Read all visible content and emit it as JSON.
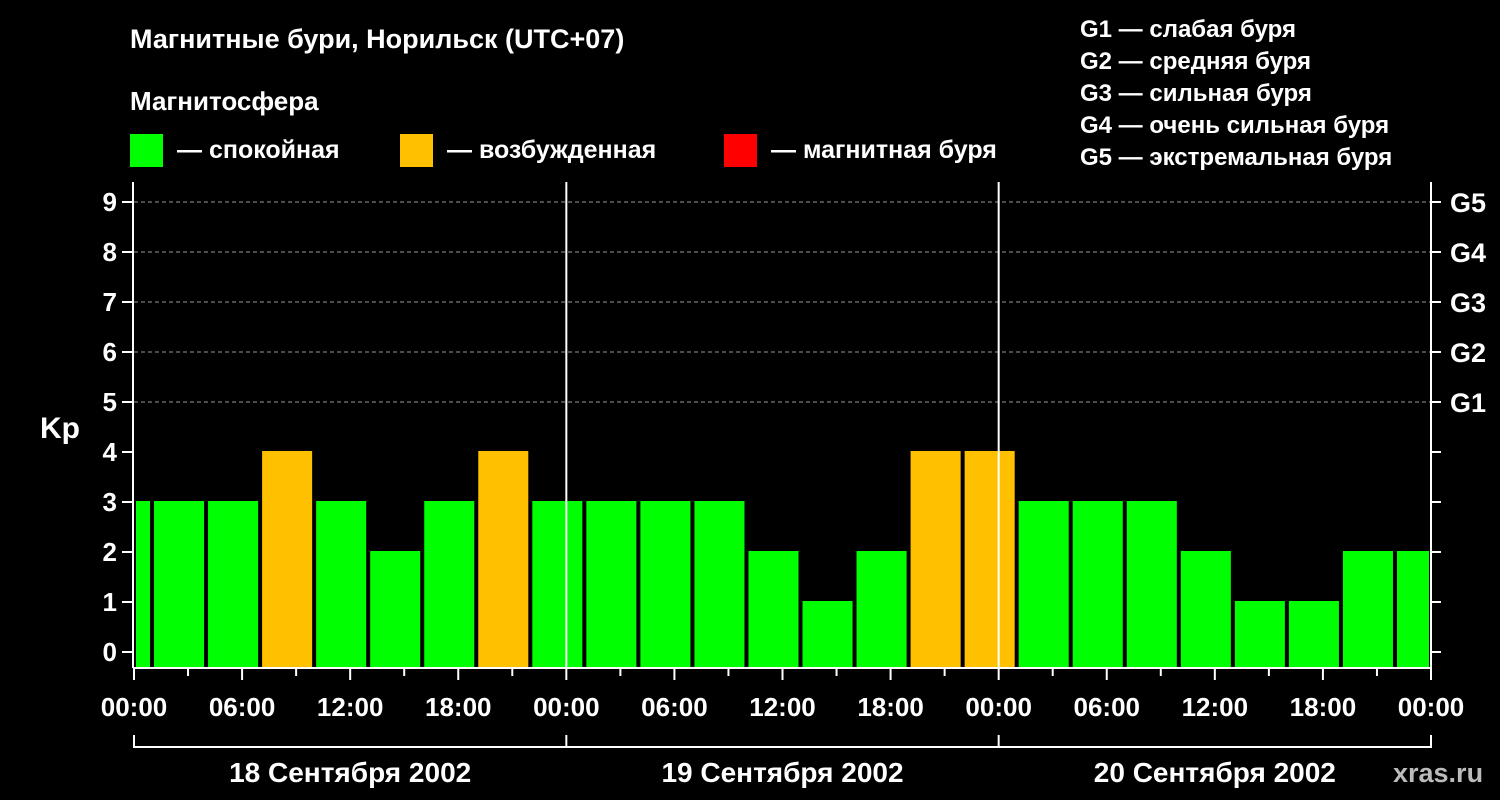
{
  "title": "Магнитные бури, Норильск (UTC+07)",
  "legend": {
    "heading": "Магнитосфера",
    "items": [
      {
        "label": "— спокойная",
        "color": "#00ff00"
      },
      {
        "label": "— возбужденная",
        "color": "#ffc000"
      },
      {
        "label": "— магнитная буря",
        "color": "#ff0000"
      }
    ]
  },
  "storm_scale": [
    "G1 — слабая буря",
    "G2 — средняя буря",
    "G3 — сильная буря",
    "G4 — очень сильная буря",
    "G5 — экстремальная буря"
  ],
  "watermark": "xras.ru",
  "chart_data": {
    "type": "bar",
    "ylabel": "Kp",
    "ylim": [
      0,
      9
    ],
    "y_ticks": [
      "0",
      "1",
      "2",
      "3",
      "4",
      "5",
      "6",
      "7",
      "8",
      "9"
    ],
    "right_ticks": [
      {
        "value": 5,
        "label": "G1"
      },
      {
        "value": 6,
        "label": "G2"
      },
      {
        "value": 7,
        "label": "G3"
      },
      {
        "value": 8,
        "label": "G4"
      },
      {
        "value": 9,
        "label": "G5"
      }
    ],
    "grid": "dashed horizontal at Kp 5–9",
    "x_range_hours": [
      0,
      72
    ],
    "x_tick_labels": [
      "00:00",
      "06:00",
      "12:00",
      "18:00",
      "00:00",
      "06:00",
      "12:00",
      "18:00",
      "00:00",
      "06:00",
      "12:00",
      "18:00",
      "00:00"
    ],
    "day_labels": [
      "18 Сентября 2002",
      "19 Сентября 2002",
      "20 Сентября 2002"
    ],
    "bars": [
      {
        "start": 0,
        "end": 1,
        "kp": 3,
        "level": "quiet"
      },
      {
        "start": 1,
        "end": 4,
        "kp": 3,
        "level": "quiet"
      },
      {
        "start": 4,
        "end": 7,
        "kp": 3,
        "level": "quiet"
      },
      {
        "start": 7,
        "end": 10,
        "kp": 4,
        "level": "active"
      },
      {
        "start": 10,
        "end": 13,
        "kp": 3,
        "level": "quiet"
      },
      {
        "start": 13,
        "end": 16,
        "kp": 2,
        "level": "quiet"
      },
      {
        "start": 16,
        "end": 19,
        "kp": 3,
        "level": "quiet"
      },
      {
        "start": 19,
        "end": 22,
        "kp": 4,
        "level": "active"
      },
      {
        "start": 22,
        "end": 25,
        "kp": 3,
        "level": "quiet"
      },
      {
        "start": 25,
        "end": 28,
        "kp": 3,
        "level": "quiet"
      },
      {
        "start": 28,
        "end": 31,
        "kp": 3,
        "level": "quiet"
      },
      {
        "start": 31,
        "end": 34,
        "kp": 3,
        "level": "quiet"
      },
      {
        "start": 34,
        "end": 37,
        "kp": 2,
        "level": "quiet"
      },
      {
        "start": 37,
        "end": 40,
        "kp": 1,
        "level": "quiet"
      },
      {
        "start": 40,
        "end": 43,
        "kp": 2,
        "level": "quiet"
      },
      {
        "start": 43,
        "end": 46,
        "kp": 4,
        "level": "active"
      },
      {
        "start": 46,
        "end": 49,
        "kp": 4,
        "level": "active"
      },
      {
        "start": 49,
        "end": 52,
        "kp": 3,
        "level": "quiet"
      },
      {
        "start": 52,
        "end": 55,
        "kp": 3,
        "level": "quiet"
      },
      {
        "start": 55,
        "end": 58,
        "kp": 3,
        "level": "quiet"
      },
      {
        "start": 58,
        "end": 61,
        "kp": 2,
        "level": "quiet"
      },
      {
        "start": 61,
        "end": 64,
        "kp": 1,
        "level": "quiet"
      },
      {
        "start": 64,
        "end": 67,
        "kp": 1,
        "level": "quiet"
      },
      {
        "start": 67,
        "end": 70,
        "kp": 2,
        "level": "quiet"
      },
      {
        "start": 70,
        "end": 72,
        "kp": 2,
        "level": "quiet"
      }
    ],
    "level_colors": {
      "quiet": "#00ff00",
      "active": "#ffc000",
      "storm": "#ff0000"
    }
  }
}
